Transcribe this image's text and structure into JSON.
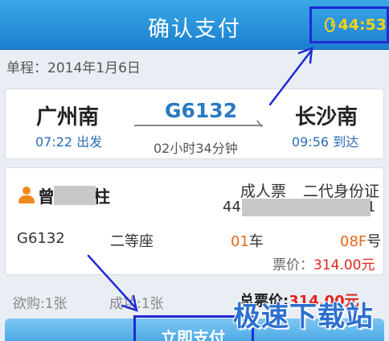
{
  "header": {
    "title": "确认支付",
    "timer": "44:53"
  },
  "trip": {
    "date_label": "单程：2014年1月6日"
  },
  "train": {
    "from_station": "广州南",
    "from_time": "07:22 出发",
    "number": "G6132",
    "duration": "02小时34分钟",
    "to_station": "长沙南",
    "to_time": "09:56 到达"
  },
  "passenger": {
    "name_first": "曾",
    "name_last": "柱",
    "ticket_type": "成人票",
    "id_type": "二代身份证",
    "id_prefix": "44",
    "id_suffix": "1",
    "train": "G6132",
    "seat_class": "二等座",
    "car_number": "01",
    "car_unit": "车",
    "seat_number": "08F",
    "seat_unit": "号",
    "fare_label": "票价：",
    "fare_value": "314.00元"
  },
  "summary": {
    "buy_count": "欲购:1张",
    "success_count": "成功:1张",
    "total_label": "总票价:",
    "total_value": "314.00元"
  },
  "actions": {
    "pay_label": "立即支付"
  },
  "watermark": "极速下载站",
  "colors": {
    "header": "#2a8fdb",
    "accent_orange": "#e8671c",
    "price_red": "#e0241b",
    "annotation_blue": "#1e2bd6"
  }
}
